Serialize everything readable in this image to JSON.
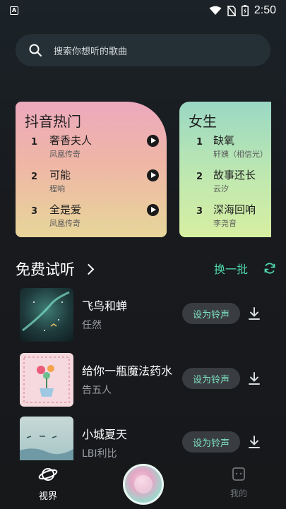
{
  "status_bar": {
    "time": "2:50",
    "icons": [
      "app-notification-icon",
      "wifi-icon",
      "no-sim-icon",
      "battery-charging-icon"
    ]
  },
  "search": {
    "placeholder": "搜索你想听的歌曲",
    "icon": "search-icon"
  },
  "charts": [
    {
      "title": "抖音热门",
      "songs": [
        {
          "rank": "1",
          "title": "奢香夫人",
          "artist": "凤凰传奇"
        },
        {
          "rank": "2",
          "title": "可能",
          "artist": "程响"
        },
        {
          "rank": "3",
          "title": "全是爱",
          "artist": "凤凰传奇"
        }
      ]
    },
    {
      "title": "女生",
      "songs": [
        {
          "rank": "1",
          "title": "缺氧",
          "artist": "轩姨（相信光）"
        },
        {
          "rank": "2",
          "title": "故事还长",
          "artist": "云汐"
        },
        {
          "rank": "3",
          "title": "深海回响",
          "artist": "李尧音"
        }
      ]
    }
  ],
  "free_trial": {
    "title": "免费试听",
    "refresh_label": "换一批",
    "items": [
      {
        "title": "飞鸟和蝉",
        "artist": "任然",
        "button": "设为铃声"
      },
      {
        "title": "给你一瓶魔法药水",
        "artist": "告五人",
        "button": "设为铃声"
      },
      {
        "title": "小城夏天",
        "artist": "LBI利比",
        "button": "设为铃声"
      }
    ]
  },
  "bottom_nav": {
    "world_label": "视界",
    "me_label": "我的"
  },
  "colors": {
    "accent": "#4fd6a8",
    "card1_top": "#eca9bd",
    "card1_bottom": "#e7d69a",
    "card2_top": "#9ad8c4",
    "card2_bottom": "#d7efa2",
    "background": "#17191c"
  }
}
